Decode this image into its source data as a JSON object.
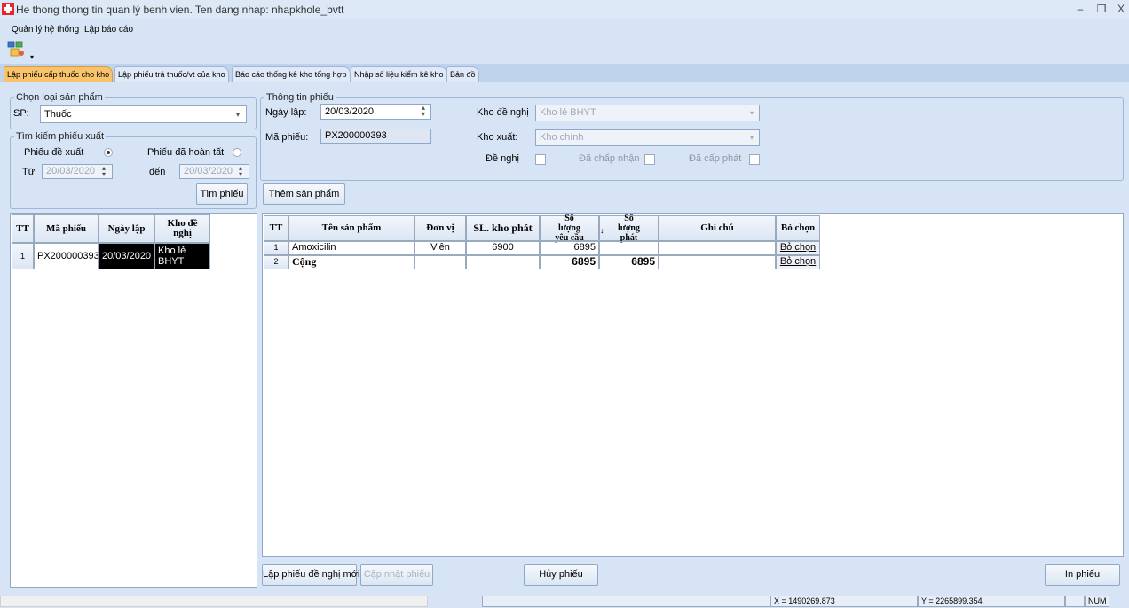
{
  "window": {
    "title": "He thong thong tin quan lý benh vien. Ten dang nhap: nhapkhole_bvtt",
    "minimize_glyph": "–",
    "restore_glyph": "❐",
    "close_glyph": "X"
  },
  "menu": {
    "items": [
      {
        "label": "Quản lý hệ thống"
      },
      {
        "label": "Lập báo cáo"
      }
    ]
  },
  "tabs": [
    {
      "label": "Lập phiếu cấp thuốc cho kho",
      "active": true
    },
    {
      "label": "Lập phiếu trả thuốc/vt của kho"
    },
    {
      "label": "Báo cáo thống kê kho tổng hợp"
    },
    {
      "label": "Nhập số liệu kiểm kê kho"
    },
    {
      "label": "Bản đồ"
    }
  ],
  "product_type": {
    "legend": "Chọn loại sản phẩm",
    "label": "SP:",
    "value": "Thuốc"
  },
  "search": {
    "legend": "Tìm kiếm phiếu xuất",
    "radio_proposed": "Phiếu đề xuất",
    "radio_completed": "Phiếu đã hoàn tất",
    "from_label": "Từ",
    "from_value": "20/03/2020",
    "to_label": "đến",
    "to_value": "20/03/2020",
    "find_button": "Tìm phiếu"
  },
  "slip_info": {
    "legend": "Thông tin phiếu",
    "date_label": "Ngày lập:",
    "date_value": "20/03/2020",
    "code_label": "Mã phiếu:",
    "code_value": "PX200000393",
    "request_store_label": "Kho đề nghị",
    "request_store_value": "Kho lẻ BHYT",
    "issue_store_label": "Kho xuất:",
    "issue_store_value": "Kho chính",
    "proposed_label": "Đề nghị",
    "accepted_label": "Đã chấp nhận",
    "issued_label": "Đã cấp phát"
  },
  "add_product_button": "Thêm sản phẩm",
  "left_grid": {
    "headers": [
      "TT",
      "Mã phiếu",
      "Ngày lập",
      "Kho đề nghị"
    ],
    "rows": [
      {
        "tt": "1",
        "code": "PX200000393",
        "date": "20/03/2020",
        "store": "Kho lẻ BHYT"
      }
    ]
  },
  "right_grid": {
    "headers": [
      "TT",
      "Tên sản phẩm",
      "Đơn vị",
      "SL. kho phát",
      "Số lượng yêu cầu",
      "Số lượng phát",
      "Ghi chú",
      "Bỏ chọn"
    ],
    "sort_glyph": "↓",
    "rows": [
      {
        "tt": "1",
        "name": "Amoxicilin",
        "unit": "Viên",
        "stock": "6900",
        "requested": "6895",
        "issued": "",
        "note": "",
        "action": "Bỏ chọn"
      },
      {
        "tt": "2",
        "name": "Cộng",
        "unit": "",
        "stock": "",
        "requested": "6895",
        "issued": "6895",
        "note": "",
        "action": "Bỏ chọn"
      }
    ]
  },
  "bottom_buttons": {
    "new_slip": "Lập phiếu đề nghị mới",
    "update_slip": "Cập nhật phiếu",
    "cancel_slip": "Hủy phiếu",
    "print_slip": "In phiếu"
  },
  "status": {
    "x": "X = 1490269.873",
    "y": "Y = 2265899.354",
    "num": "NUM"
  },
  "colors": {
    "active_tab": "#f9c36b",
    "background": "#d6e4f5",
    "selected_cell": "#000000"
  }
}
